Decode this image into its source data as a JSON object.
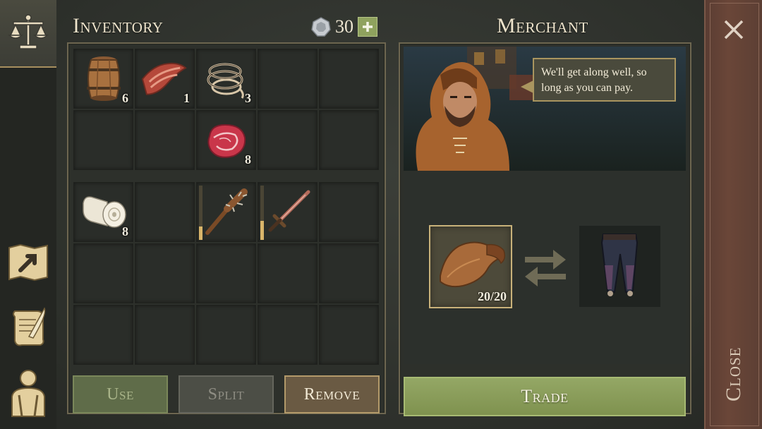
{
  "sidebar": {
    "active_tab": "scales-icon",
    "items": [
      "scales-icon",
      "map-arrow-icon",
      "quill-scroll-icon",
      "character-icon"
    ]
  },
  "inventory": {
    "title": "Inventory",
    "currency_amount": "30",
    "slots": [
      {
        "item": "barrel",
        "qty": "6"
      },
      {
        "item": "raw-bacon",
        "qty": "1"
      },
      {
        "item": "rope",
        "qty": "3"
      },
      {
        "item": "",
        "qty": ""
      },
      {
        "item": "",
        "qty": ""
      },
      {
        "item": "",
        "qty": ""
      },
      {
        "item": "",
        "qty": ""
      },
      {
        "item": "raw-meat",
        "qty": "8"
      },
      {
        "item": "",
        "qty": ""
      },
      {
        "item": "",
        "qty": ""
      }
    ],
    "equip_slots": [
      {
        "item": "bandage-roll",
        "qty": "8"
      },
      {
        "item": "",
        "qty": ""
      },
      {
        "item": "spiked-club",
        "qty": "",
        "durability": 0.25
      },
      {
        "item": "sword",
        "qty": "",
        "durability": 0.35
      },
      {
        "item": "",
        "qty": ""
      }
    ],
    "buttons": {
      "use": "Use",
      "split": "Split",
      "remove": "Remove"
    }
  },
  "merchant": {
    "title": "Merchant",
    "speech": "We'll get along well, so long as you can pay.",
    "offer_item": "leather",
    "offer_qty": "20/20",
    "receive_item": "leather-pants",
    "trade_label": "Trade"
  },
  "close_label": "Close",
  "colors": {
    "accent_green": "#8fa25e",
    "gold_border": "#c9b27a",
    "close_bg": "#6a4638"
  }
}
